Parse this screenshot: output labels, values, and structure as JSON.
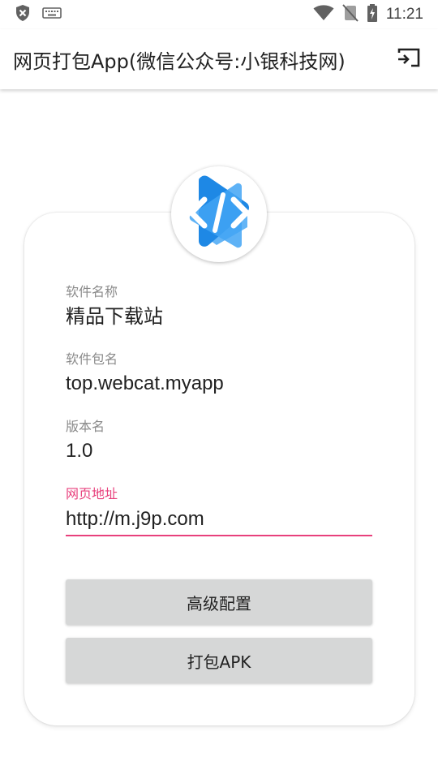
{
  "status_bar": {
    "time": "11:21",
    "icons": [
      "shield-x-icon",
      "keyboard-icon",
      "wifi-icon",
      "no-sim-icon",
      "battery-charging-icon"
    ]
  },
  "app_bar": {
    "title": "网页打包App(微信公众号:小银科技网)",
    "action_icon": "cast-icon"
  },
  "form": {
    "app_name": {
      "label": "软件名称",
      "value": "精品下载站"
    },
    "package_name": {
      "label": "软件包名",
      "value": "top.webcat.myapp"
    },
    "version_name": {
      "label": "版本名",
      "value": "1.0"
    },
    "url": {
      "label": "网页地址",
      "value": "http://m.j9p.com"
    }
  },
  "buttons": {
    "advanced": "高级配置",
    "build": "打包APK"
  },
  "colors": {
    "accent": "#e8407c",
    "button_bg": "#d6d7d7",
    "logo_blue": "#1e88e5"
  }
}
